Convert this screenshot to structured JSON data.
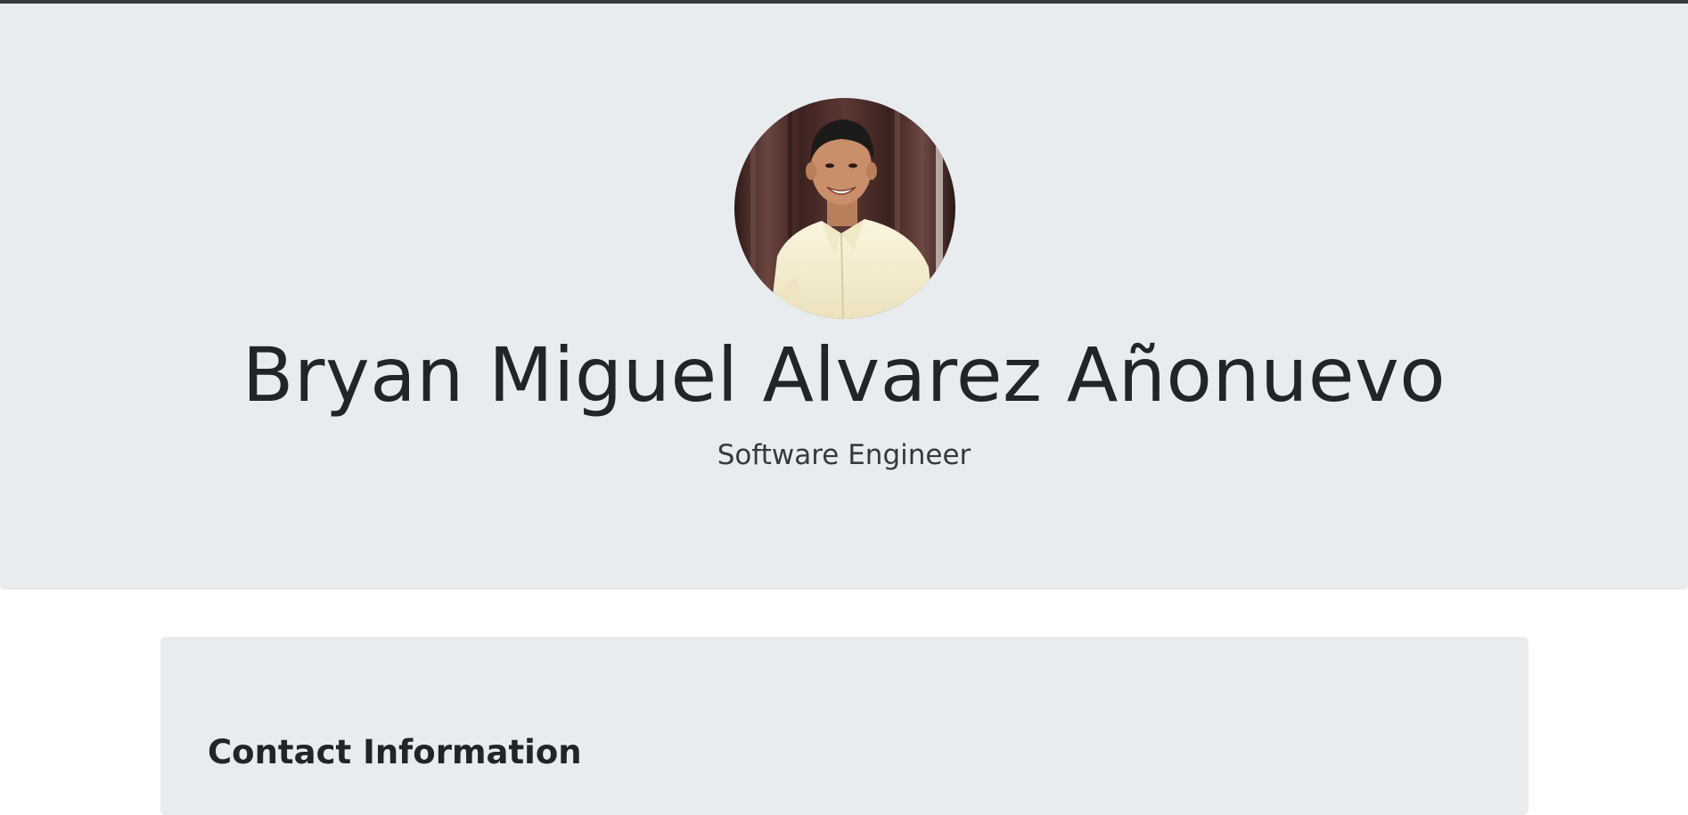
{
  "header": {
    "name": "Bryan Miguel Alvarez Añonuevo",
    "role": "Software Engineer",
    "avatar": {
      "icon": "profile-photo",
      "description_colors": {
        "curtain": "#4a2a26",
        "shirt": "#f7f0d6",
        "skin": "#c98e6a",
        "hair": "#1d1a1a"
      }
    }
  },
  "contact": {
    "heading": "Contact Information"
  },
  "colors": {
    "top_bar": "#343a40",
    "hero_background": "#e9ecef",
    "card_background": "#e9ecef",
    "text": "#212529"
  }
}
